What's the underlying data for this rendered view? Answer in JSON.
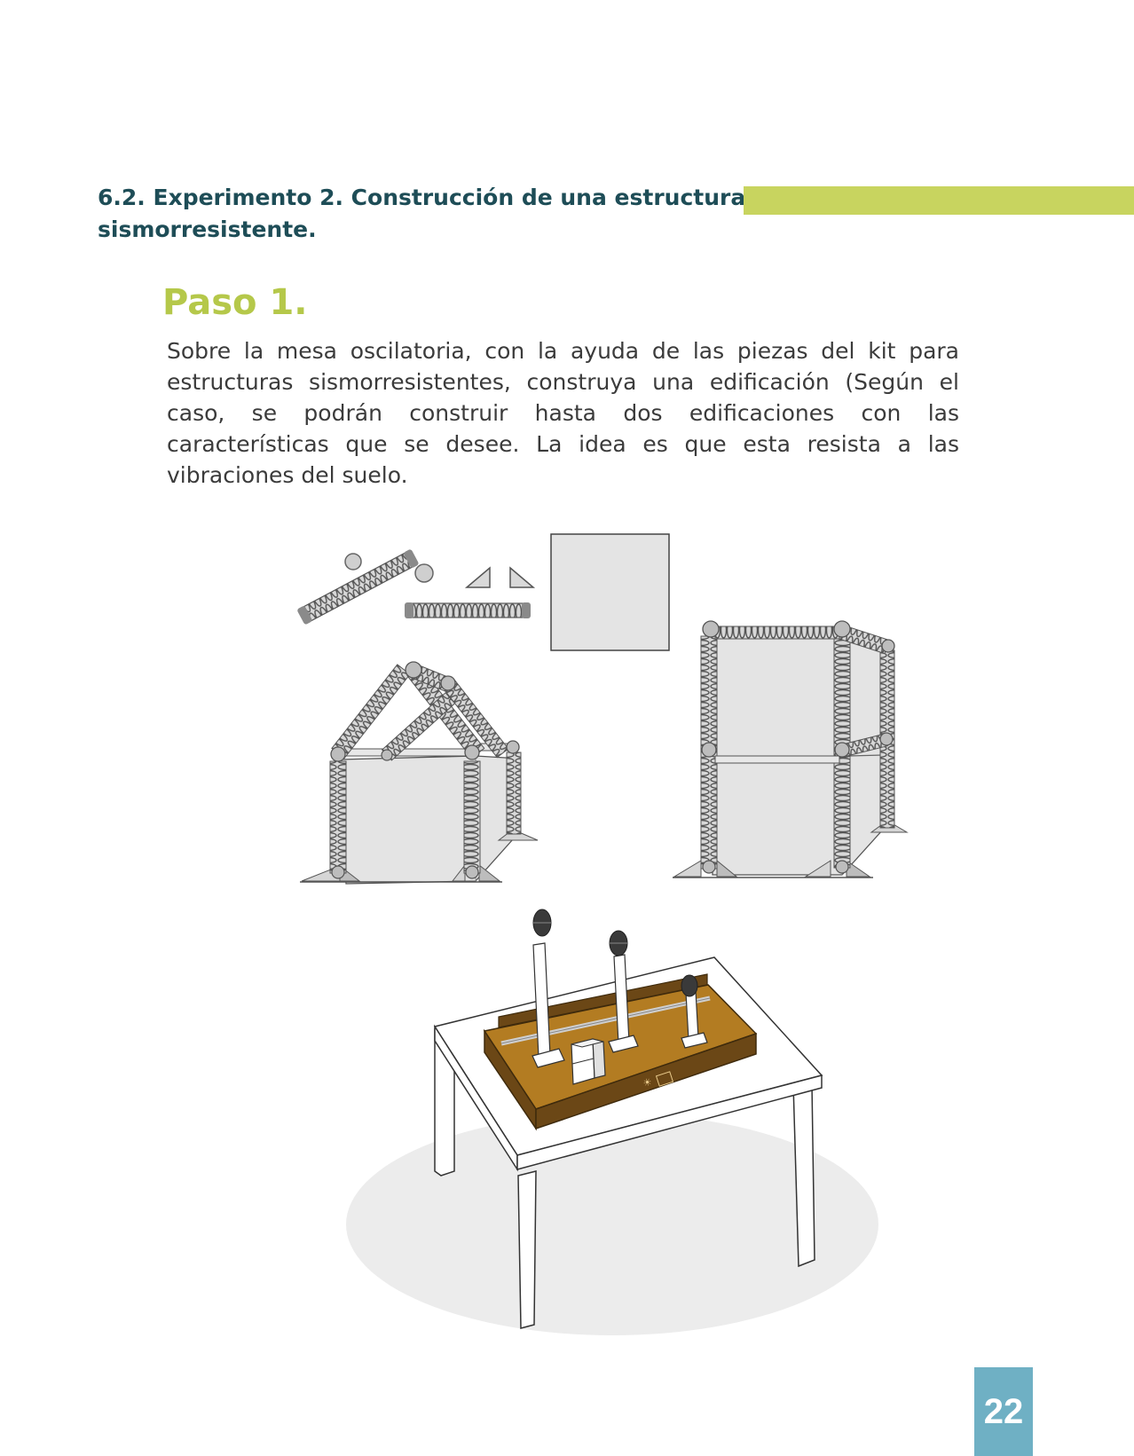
{
  "section": {
    "heading": "6.2. Experimento 2. Construcción de una estructura sismorresistente."
  },
  "step": {
    "title": "Paso 1.",
    "body": "Sobre la mesa oscilatoria, con la ayuda de las piezas del kit para estructuras sismorresistentes, construya una edificación (Según el caso, se podrán construir hasta dos edificaciones con las características que se desee. La idea es que esta resista a las vibraciones del suelo."
  },
  "illustration": {
    "parts": [
      "sphere-connector",
      "spring-element",
      "triangle-base",
      "square-panel"
    ],
    "buildings": [
      "gable-roof-building",
      "two-story-building"
    ],
    "equipment": "shake-table-on-desk"
  },
  "colors": {
    "heading": "#1e4d57",
    "accent_bar": "#c8d45f",
    "step_title": "#b5c84a",
    "page_badge": "#6fb0c4",
    "table_wood": "#b37c22",
    "table_frame": "#6b4716"
  },
  "page_number": "22"
}
